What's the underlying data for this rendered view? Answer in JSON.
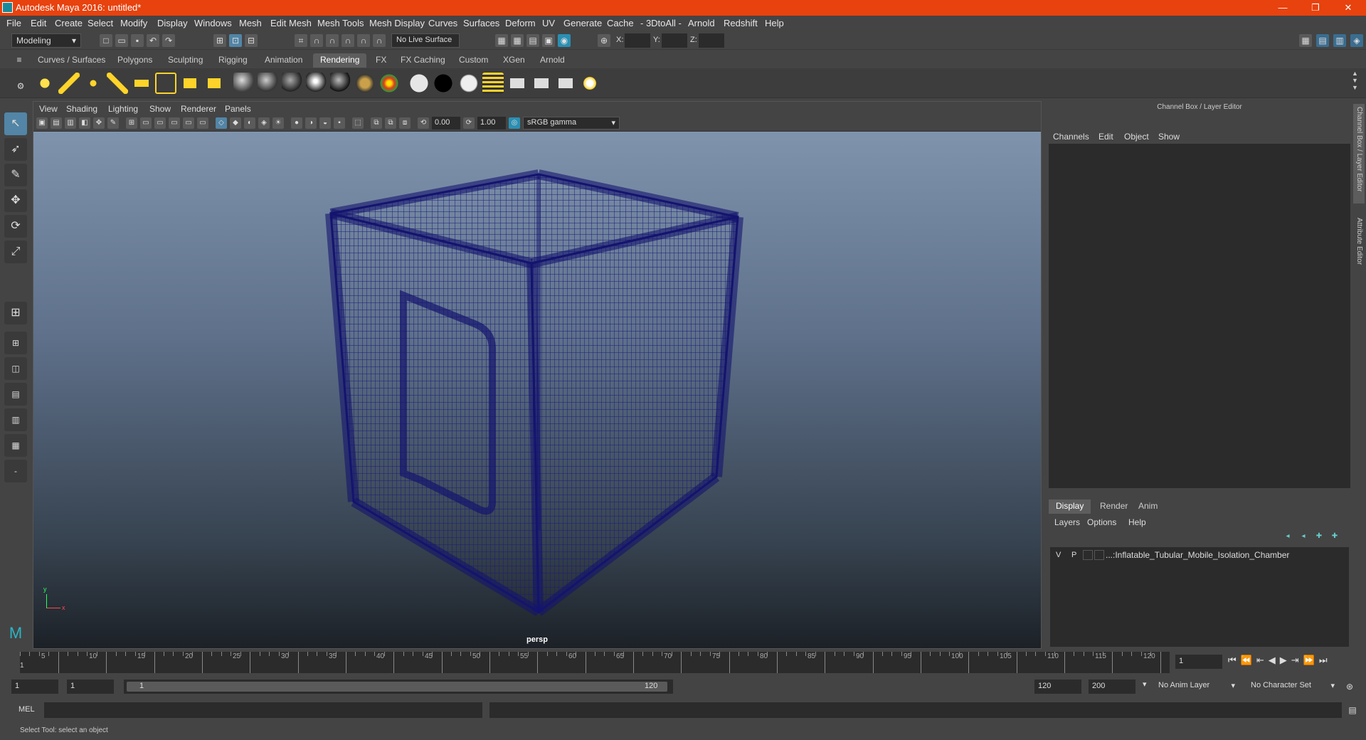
{
  "window": {
    "title": "Autodesk Maya 2016: untitled*",
    "minimize": "—",
    "restore": "❐",
    "close": "✕"
  },
  "menus": [
    "File",
    "Edit",
    "Create",
    "Select",
    "Modify",
    "Display",
    "Windows",
    "Mesh",
    "Edit Mesh",
    "Mesh Tools",
    "Mesh Display",
    "Curves",
    "Surfaces",
    "Deform",
    "UV",
    "Generate",
    "Cache",
    "- 3DtoAll -",
    "Arnold",
    "Redshift",
    "Help"
  ],
  "statusline": {
    "mode": "Modeling",
    "live_surface": "No Live Surface",
    "x_label": "X:",
    "y_label": "Y:",
    "z_label": "Z:"
  },
  "shelf_tabs": [
    "Curves / Surfaces",
    "Polygons",
    "Sculpting",
    "Rigging",
    "Animation",
    "Rendering",
    "FX",
    "FX Caching",
    "Custom",
    "XGen",
    "Arnold"
  ],
  "shelf_active": "Rendering",
  "viewport": {
    "menus": [
      "View",
      "Shading",
      "Lighting",
      "Show",
      "Renderer",
      "Panels"
    ],
    "exposure": "0.00",
    "gamma": "1.00",
    "colorspace": "sRGB gamma",
    "camera_label": "persp",
    "axis_y": "y",
    "axis_x": "x"
  },
  "channel_box": {
    "header": "Channel Box / Layer Editor",
    "menus": [
      "Channels",
      "Edit",
      "Object",
      "Show"
    ]
  },
  "layer_editor": {
    "tabs": [
      "Display",
      "Render",
      "Anim"
    ],
    "active_tab": "Display",
    "menus": [
      "Layers",
      "Options",
      "Help"
    ],
    "layer": {
      "v": "V",
      "p": "P",
      "name": "...:Inflatable_Tubular_Mobile_Isolation_Chamber"
    }
  },
  "side_tabs": [
    "Channel Box / Layer Editor",
    "Attribute Editor"
  ],
  "timeline": {
    "ticks": [
      "5",
      "10",
      "15",
      "20",
      "25",
      "30",
      "35",
      "40",
      "45",
      "50",
      "55",
      "60",
      "65",
      "70",
      "75",
      "80",
      "85",
      "90",
      "95",
      "100",
      "105",
      "110",
      "115",
      "120"
    ],
    "start_label": "1",
    "current_frame": "1"
  },
  "range": {
    "start": "1",
    "playback_start": "1",
    "slider_start": "1",
    "slider_end": "120",
    "playback_end": "120",
    "end": "200",
    "anim_layer": "No Anim Layer",
    "char_set": "No Character Set"
  },
  "cmd": {
    "label": "MEL"
  },
  "help": {
    "text": "Select Tool: select an object"
  }
}
